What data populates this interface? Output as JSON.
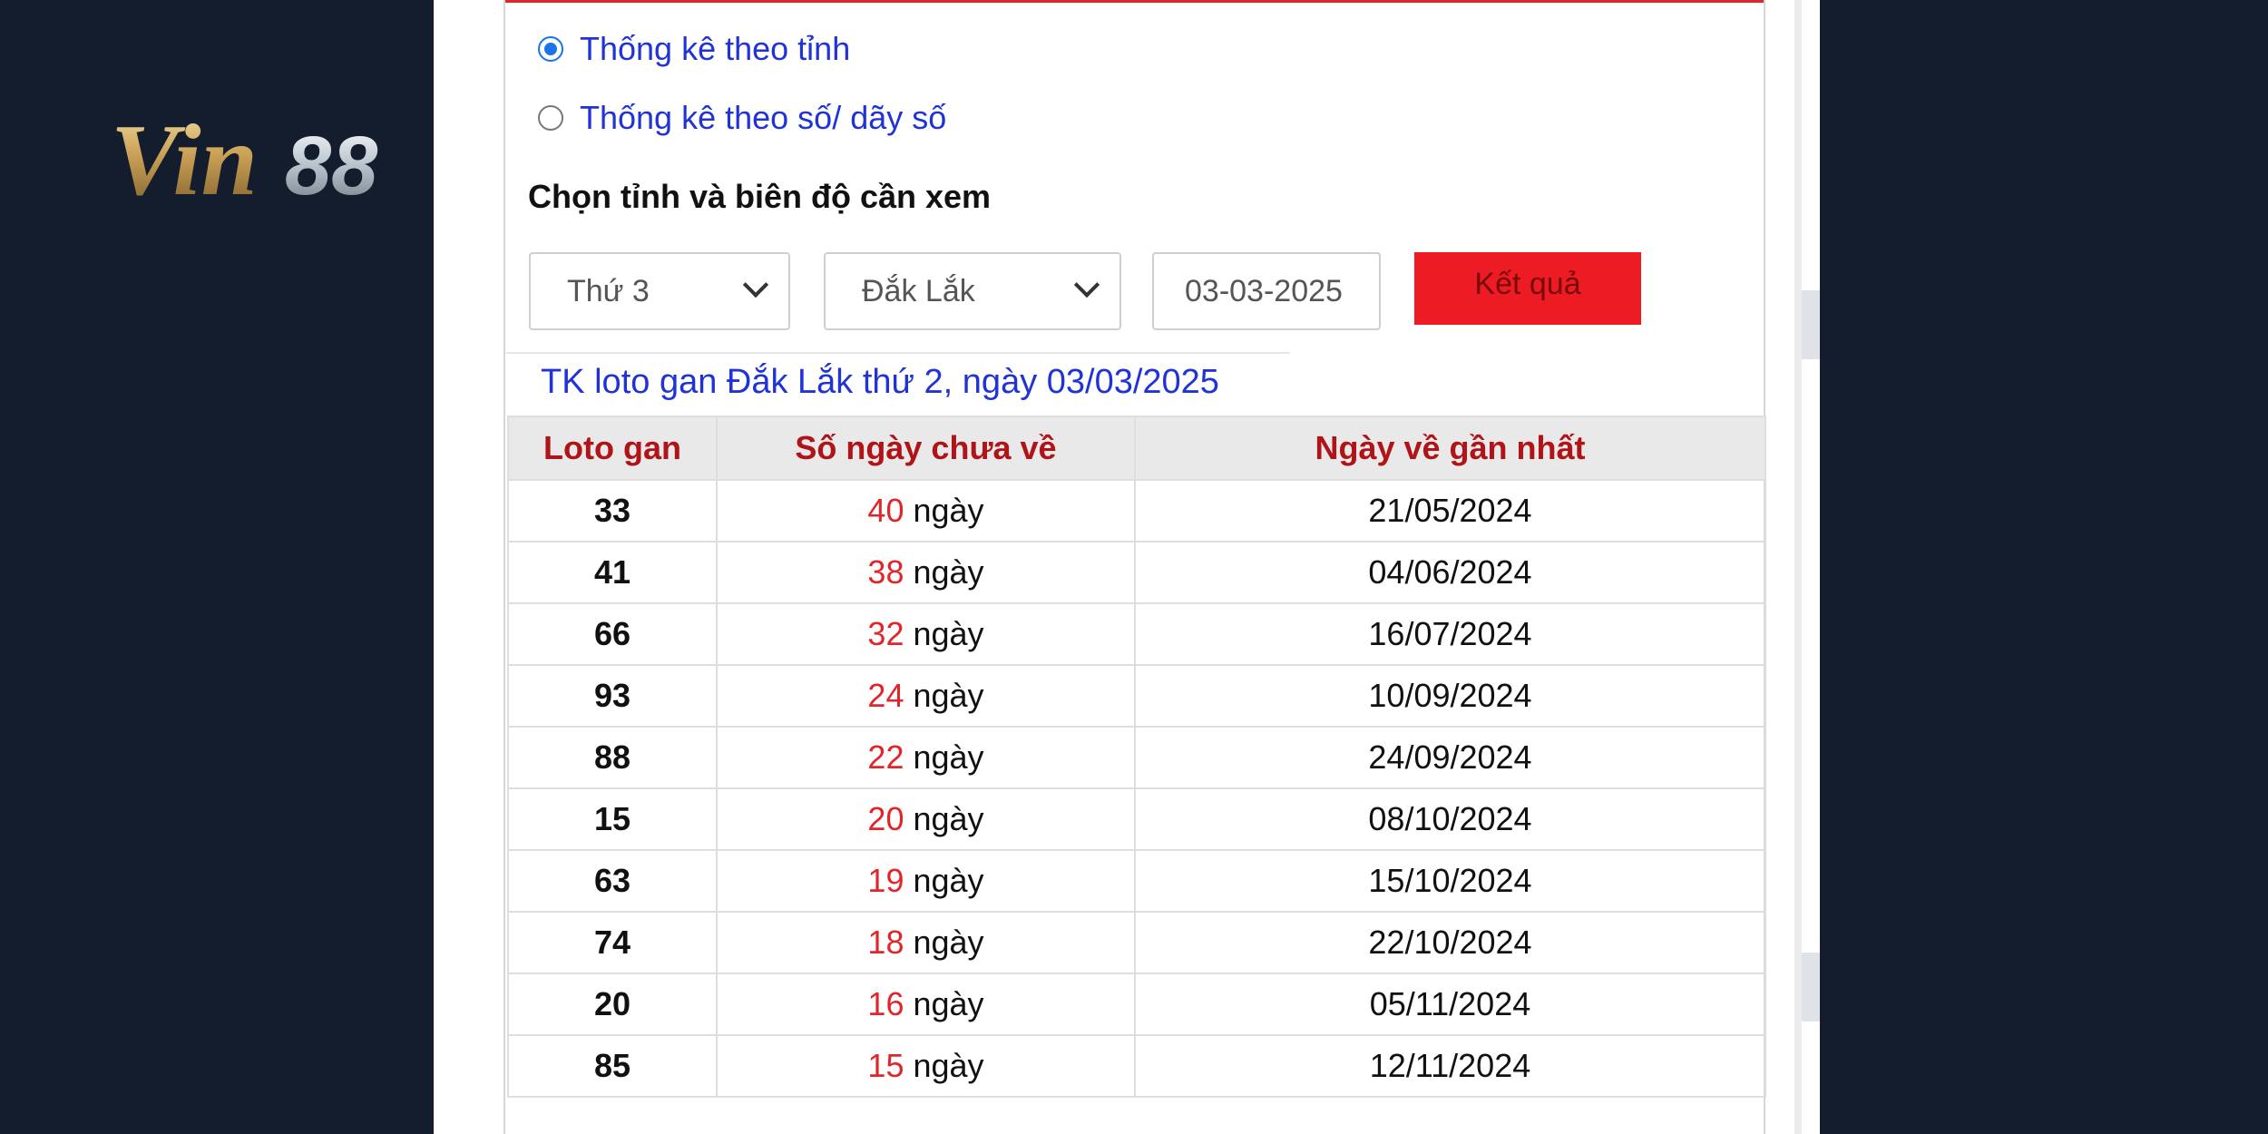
{
  "brand": {
    "logo_text": "Vin88"
  },
  "form": {
    "radio_province": {
      "label": "Thống kê theo tỉnh",
      "selected": true
    },
    "radio_number": {
      "label": "Thống kê theo số/ dãy số",
      "selected": false
    },
    "section_label": "Chọn tỉnh và biên độ cần xem",
    "day_select": "Thứ 3",
    "province_select": "Đắk Lắk",
    "date_value": "03-03-2025",
    "submit_label": "Kết quả"
  },
  "caption": "TK loto gan Đắk Lắk thứ 2, ngày 03/03/2025",
  "table": {
    "headers": [
      "Loto gan",
      "Số ngày chưa về",
      "Ngày về gần nhất"
    ],
    "day_unit": "ngày",
    "rows": [
      {
        "loto": "33",
        "days": "40",
        "last": "21/05/2024"
      },
      {
        "loto": "41",
        "days": "38",
        "last": "04/06/2024"
      },
      {
        "loto": "66",
        "days": "32",
        "last": "16/07/2024"
      },
      {
        "loto": "93",
        "days": "24",
        "last": "10/09/2024"
      },
      {
        "loto": "88",
        "days": "22",
        "last": "24/09/2024"
      },
      {
        "loto": "15",
        "days": "20",
        "last": "08/10/2024"
      },
      {
        "loto": "63",
        "days": "19",
        "last": "15/10/2024"
      },
      {
        "loto": "74",
        "days": "18",
        "last": "22/10/2024"
      },
      {
        "loto": "20",
        "days": "16",
        "last": "05/11/2024"
      },
      {
        "loto": "85",
        "days": "15",
        "last": "12/11/2024"
      }
    ]
  },
  "colors": {
    "background": "#141d2d",
    "accent_red": "#ed1c24",
    "link_blue": "#1f33d6",
    "header_red": "#b01318"
  }
}
